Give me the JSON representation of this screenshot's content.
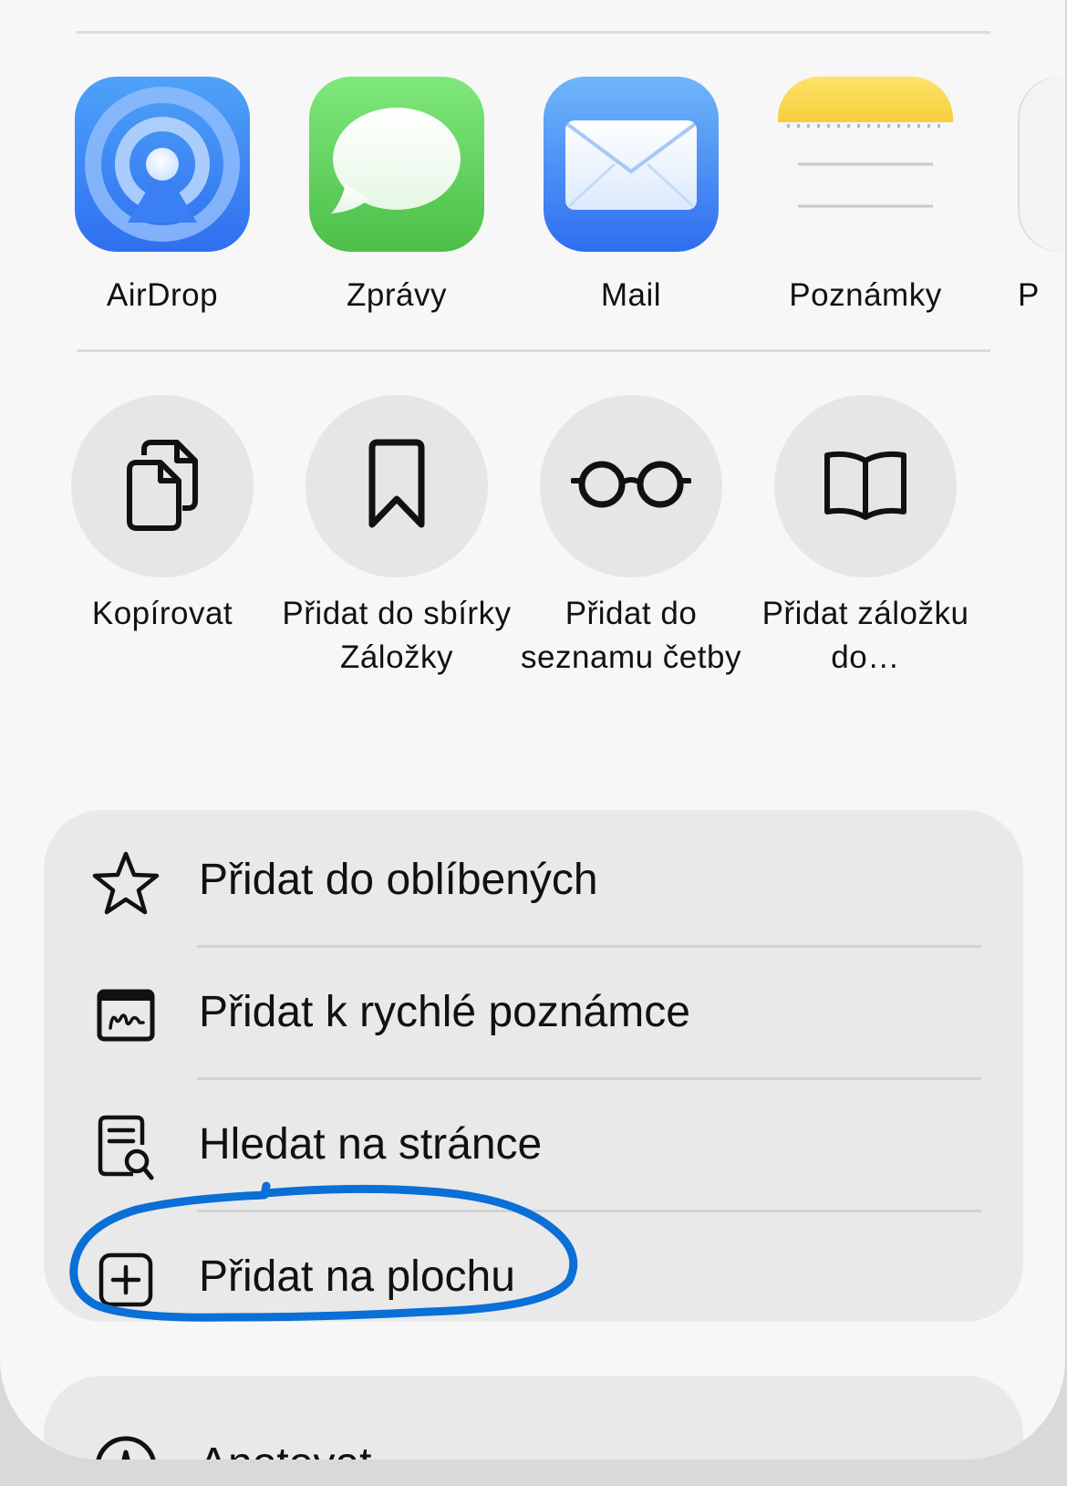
{
  "share_targets": [
    {
      "label": "AirDrop",
      "icon": "airdrop-icon"
    },
    {
      "label": "Zprávy",
      "icon": "messages-icon"
    },
    {
      "label": "Mail",
      "icon": "mail-icon"
    },
    {
      "label": "Poznámky",
      "icon": "notes-icon"
    },
    {
      "label": "P",
      "icon": "reminders-icon"
    }
  ],
  "actions": [
    {
      "label": "Kopírovat",
      "icon": "copy-icon"
    },
    {
      "label": "Přidat do sbírky Záložky",
      "icon": "bookmark-icon"
    },
    {
      "label": "Přidat do seznamu četby",
      "icon": "glasses-icon"
    },
    {
      "label": "Přidat záložku do…",
      "icon": "book-icon"
    }
  ],
  "menu": [
    {
      "label": "Přidat do oblíbených",
      "icon": "star-icon"
    },
    {
      "label": "Přidat k rychlé poznámce",
      "icon": "quick-note-icon"
    },
    {
      "label": "Hledat na stránce",
      "icon": "find-on-page-icon"
    },
    {
      "label": "Přidat na plochu",
      "icon": "add-square-icon",
      "highlighted": true
    }
  ],
  "menu2": [
    {
      "label": "Anotovat",
      "icon": "markup-icon"
    }
  ],
  "colors": {
    "highlight": "#0a6fd6",
    "sheet_bg": "#f7f7f7",
    "menu_bg": "#e9e9e9",
    "airdrop_blue": "#3d87f5",
    "messages_green": "#5fd05d",
    "mail_blue": "#3f8cf5",
    "notes_yellow": "#f8d94a"
  }
}
